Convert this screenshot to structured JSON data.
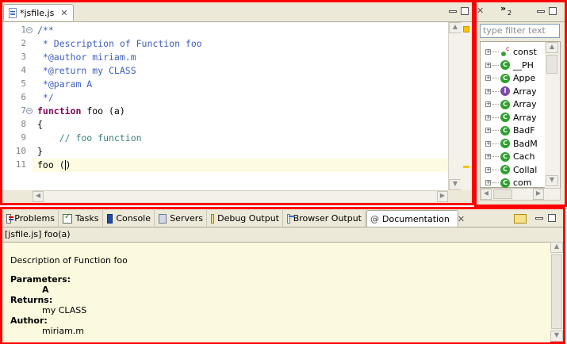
{
  "editor": {
    "tab_title": "*jsfile.js",
    "close_glyph": "✕",
    "lines": [
      {
        "num": "1",
        "parts": [
          {
            "cls": "cmt",
            "text": "/**"
          }
        ],
        "fold": "−"
      },
      {
        "num": "2",
        "parts": [
          {
            "cls": "cmt",
            "text": " * Description of Function foo"
          }
        ]
      },
      {
        "num": "3",
        "parts": [
          {
            "cls": "cmt",
            "text": " *@author miriam.m"
          }
        ]
      },
      {
        "num": "4",
        "parts": [
          {
            "cls": "cmt",
            "text": " *@return my CLASS"
          }
        ]
      },
      {
        "num": "5",
        "parts": [
          {
            "cls": "cmt",
            "text": " *@param A"
          }
        ]
      },
      {
        "num": "6",
        "parts": [
          {
            "cls": "cmt",
            "text": " */"
          }
        ]
      },
      {
        "num": "7",
        "parts": [
          {
            "cls": "kw",
            "text": "function"
          },
          {
            "cls": "",
            "text": " foo (a)"
          }
        ],
        "fold": "−"
      },
      {
        "num": "8",
        "parts": [
          {
            "cls": "",
            "text": "{"
          }
        ]
      },
      {
        "num": "9",
        "parts": [
          {
            "cls": "cmt2",
            "text": "    // foo function"
          }
        ]
      },
      {
        "num": "10",
        "parts": [
          {
            "cls": "",
            "text": "}"
          }
        ]
      },
      {
        "num": "11",
        "parts": [
          {
            "cls": "",
            "text": "foo ("
          },
          {
            "cls": "caret",
            "text": ""
          },
          {
            "cls": "",
            "text": ")"
          }
        ]
      }
    ],
    "current_line": 11,
    "colors": {
      "comment": "#3f5fbf",
      "line_comment": "#3f7f7f",
      "keyword": "#7f0055",
      "current_line": "#fdfbe1"
    }
  },
  "outline": {
    "tab_count": "2",
    "tab_glyph": "»",
    "filter_placeholder": "type filter text",
    "items": [
      {
        "icon": "variable-icon",
        "label": "const"
      },
      {
        "icon": "class-icon",
        "label": "__PH"
      },
      {
        "icon": "class-icon",
        "label": "Appe"
      },
      {
        "icon": "interface-icon",
        "label": "Array"
      },
      {
        "icon": "class-icon",
        "label": "Array"
      },
      {
        "icon": "class-icon",
        "label": "Array"
      },
      {
        "icon": "class-icon",
        "label": "BadF"
      },
      {
        "icon": "class-icon",
        "label": "BadM"
      },
      {
        "icon": "class-icon",
        "label": "Cach"
      },
      {
        "icon": "class-icon",
        "label": "Collal"
      },
      {
        "icon": "class-icon",
        "label": "com"
      }
    ]
  },
  "bottom": {
    "tabs": [
      {
        "icon": "problems-icon",
        "label": "Problems"
      },
      {
        "icon": "tasks-icon",
        "label": "Tasks"
      },
      {
        "icon": "console-icon",
        "label": "Console"
      },
      {
        "icon": "servers-icon",
        "label": "Servers"
      },
      {
        "icon": "debug-output-icon",
        "label": "Debug Output"
      },
      {
        "icon": "browser-output-icon",
        "label": "Browser Output"
      },
      {
        "icon": "at-icon",
        "label": "Documentation",
        "active": true
      }
    ],
    "breadcrumb": "[jsfile.js] foo(a)",
    "doc": {
      "description": "Description of Function foo",
      "params_label": "Parameters:",
      "param": "A",
      "returns_label": "Returns:",
      "returns": "my CLASS",
      "author_label": "Author:",
      "author": "miriam.m"
    }
  }
}
